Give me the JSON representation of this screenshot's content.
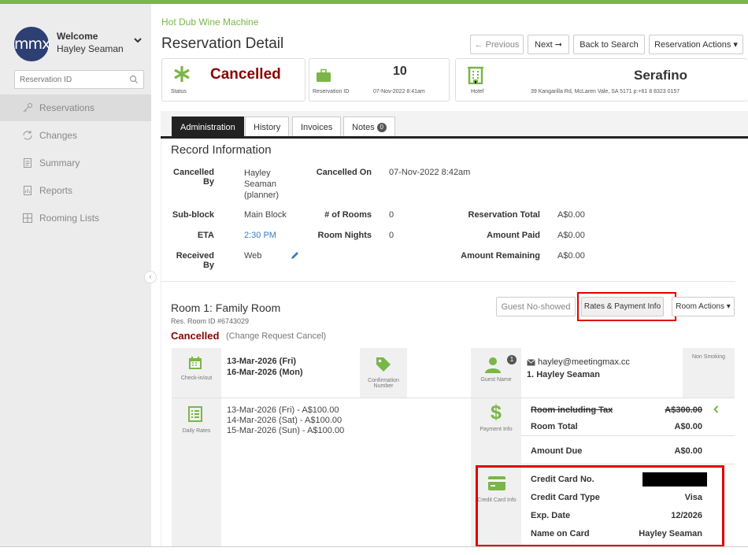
{
  "sidebar": {
    "avatar_text": "mmx",
    "welcome": "Welcome",
    "user": "Hayley Seaman",
    "search_placeholder": "Reservation ID",
    "items": [
      {
        "label": "Reservations",
        "icon": "key-icon"
      },
      {
        "label": "Changes",
        "icon": "refresh-icon"
      },
      {
        "label": "Summary",
        "icon": "document-icon"
      },
      {
        "label": "Reports",
        "icon": "report-icon"
      },
      {
        "label": "Rooming Lists",
        "icon": "rooming-list-icon"
      }
    ]
  },
  "header": {
    "app_name": "Hot Dub Wine Machine",
    "page_title": "Reservation Detail",
    "prev_label": "← Previous",
    "next_label": "Next ➞",
    "back_label": "Back to Search",
    "actions_label": "Reservation Actions ▾"
  },
  "summary": {
    "status": "Cancelled",
    "status_caption": "Status",
    "reservation_caption": "Reservation ID",
    "reservation_id": "10",
    "reservation_date": "07-Nov-2022 8:41am",
    "hotel_caption": "Hotel",
    "hotel_name": "Serafino",
    "hotel_address": "39 Kangarilla Rd, McLaren Vale, SA 5171 p:+61 8 8323 0157"
  },
  "tabs": [
    {
      "label": "Administration"
    },
    {
      "label": "History"
    },
    {
      "label": "Invoices"
    },
    {
      "label": "Notes",
      "badge": "0"
    }
  ],
  "record": {
    "title": "Record Information",
    "cancelled_by_label": "Cancelled By",
    "cancelled_by_value": "Hayley Seaman (planner)",
    "cancelled_on_label": "Cancelled On",
    "cancelled_on_value": "07-Nov-2022 8:42am",
    "subblock_label": "Sub-block",
    "subblock_value": "Main Block",
    "rooms_label": "# of Rooms",
    "rooms_value": "0",
    "res_total_label": "Reservation Total",
    "res_total_value": "A$0.00",
    "eta_label": "ETA",
    "eta_value": "2:30 PM",
    "nights_label": "Room Nights",
    "nights_value": "0",
    "paid_label": "Amount Paid",
    "paid_value": "A$0.00",
    "received_label": "Received By",
    "received_value": "Web",
    "remaining_label": "Amount Remaining",
    "remaining_value": "A$0.00"
  },
  "room": {
    "title": "Room 1: Family Room",
    "res_room_id": "Res. Room ID #6743029",
    "status": "Cancelled",
    "status_note": "(Change Request Cancel)",
    "no_show_label": "Guest No-showed",
    "rates_label": "Rates & Payment Info",
    "room_actions_label": "Room Actions ▾",
    "checkin_caption": "Check-in/out",
    "checkin": "13-Mar-2026 (Fri)",
    "checkout": "16-Mar-2026 (Mon)",
    "confirmation_caption": "Confirmation Number",
    "guest_caption": "Guest Name",
    "guest_badge": "1",
    "guest_email": "hayley@meetingmax.cc",
    "guest_name": "1. Hayley Seaman",
    "smoking": "Non Smoking",
    "daily_rates_caption": "Daily Rates",
    "daily_rates": [
      "13-Mar-2026 (Fri) - A$100.00",
      "14-Mar-2026 (Sat) - A$100.00",
      "15-Mar-2026 (Sun) - A$100.00"
    ],
    "payment_caption": "Payment Info",
    "room_incl_tax_label": "Room including Tax",
    "room_incl_tax_value": "A$300.00",
    "room_total_label": "Room Total",
    "room_total_value": "A$0.00",
    "amount_due_label": "Amount Due",
    "amount_due_value": "A$0.00",
    "cc_caption": "Credit Card Info",
    "cc_no_label": "Credit Card No.",
    "cc_type_label": "Credit Card Type",
    "cc_type_value": "Visa",
    "exp_label": "Exp. Date",
    "exp_value": "12/2026",
    "name_label": "Name on Card",
    "name_value": "Hayley Seaman"
  },
  "colors": {
    "accent": "#7ab648",
    "cancelled": "#8b0000",
    "highlight": "#e00000"
  }
}
